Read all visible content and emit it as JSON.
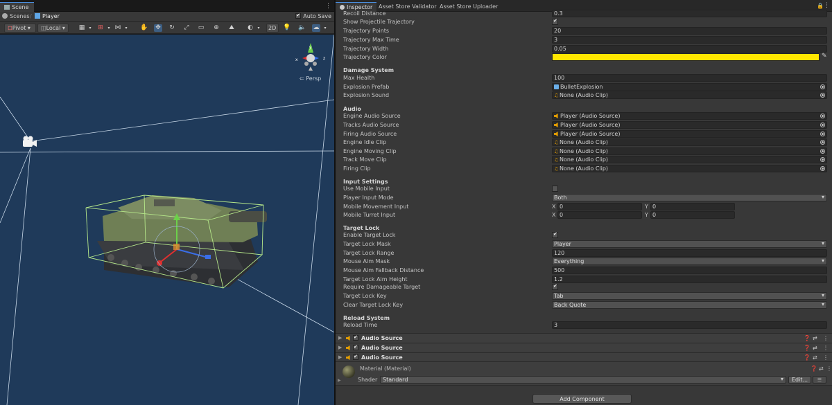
{
  "scene": {
    "tab_label": "Scene",
    "breadcrumb": {
      "root": "Scenes",
      "current": "Player"
    },
    "autosave_label": "Auto Save",
    "autosave_checked": true,
    "toolbar": {
      "pivot": "Pivot",
      "local": "Local",
      "mode_2d": "2D"
    },
    "persp_label": "Persp"
  },
  "inspector": {
    "tabs": [
      "Inspector",
      "Asset Store Validator",
      "Asset Store Uploader"
    ],
    "rows_top": [
      {
        "label": "Recoil Distance",
        "type": "text",
        "value": "0.3"
      },
      {
        "label": "Show Projectile Trajectory",
        "type": "check",
        "value": true
      },
      {
        "label": "Trajectory Points",
        "type": "text",
        "value": "20"
      },
      {
        "label": "Trajectory Max Time",
        "type": "text",
        "value": "3"
      },
      {
        "label": "Trajectory Width",
        "type": "text",
        "value": "0.05"
      },
      {
        "label": "Trajectory Color",
        "type": "color",
        "value": "#ffe600"
      }
    ],
    "damage": {
      "header": "Damage System",
      "max_health_label": "Max Health",
      "max_health": "100",
      "explosion_prefab_label": "Explosion Prefab",
      "explosion_prefab": "BulletExplosion",
      "explosion_sound_label": "Explosion Sound",
      "explosion_sound": "None (Audio Clip)"
    },
    "audio": {
      "header": "Audio",
      "rows": [
        {
          "label": "Engine Audio Source",
          "value": "Player (Audio Source)",
          "icon": "speaker-icon"
        },
        {
          "label": "Tracks Audio Source",
          "value": "Player (Audio Source)",
          "icon": "speaker-icon"
        },
        {
          "label": "Firing Audio Source",
          "value": "Player (Audio Source)",
          "icon": "speaker-icon"
        },
        {
          "label": "Engine Idle Clip",
          "value": "None (Audio Clip)",
          "icon": "audio-clip-icon"
        },
        {
          "label": "Engine Moving Clip",
          "value": "None (Audio Clip)",
          "icon": "audio-clip-icon"
        },
        {
          "label": "Track Move Clip",
          "value": "None (Audio Clip)",
          "icon": "audio-clip-icon"
        },
        {
          "label": "Firing Clip",
          "value": "None (Audio Clip)",
          "icon": "audio-clip-icon"
        }
      ]
    },
    "input": {
      "header": "Input Settings",
      "use_mobile_label": "Use Mobile Input",
      "use_mobile": false,
      "player_input_mode_label": "Player Input Mode",
      "player_input_mode": "Both",
      "mobile_movement_label": "Mobile Movement Input",
      "mobile_turret_label": "Mobile Turret Input",
      "x_label": "X",
      "y_label": "Y",
      "movement_x": "0",
      "movement_y": "0",
      "turret_x": "0",
      "turret_y": "0"
    },
    "target_lock": {
      "header": "Target Lock",
      "enable_label": "Enable Target Lock",
      "enable": true,
      "mask_label": "Target Lock Mask",
      "mask": "Player",
      "range_label": "Target Lock Range",
      "range": "120",
      "mouse_mask_label": "Mouse Aim Mask",
      "mouse_mask": "Everything",
      "fallback_label": "Mouse Aim Fallback Distance",
      "fallback": "500",
      "aim_height_label": "Target Lock Aim Height",
      "aim_height": "1.2",
      "require_label": "Require Damageable Target",
      "require": true,
      "key_label": "Target Lock Key",
      "key": "Tab",
      "clear_key_label": "Clear Target Lock Key",
      "clear_key": "Back Quote"
    },
    "reload": {
      "header": "Reload System",
      "time_label": "Reload Time",
      "time": "3"
    },
    "components": [
      {
        "title": "Audio Source"
      },
      {
        "title": "Audio Source"
      },
      {
        "title": "Audio Source"
      }
    ],
    "material": {
      "title": "Material (Material)",
      "shader_label": "Shader",
      "shader": "Standard",
      "edit_label": "Edit..."
    },
    "add_component_label": "Add Component"
  }
}
